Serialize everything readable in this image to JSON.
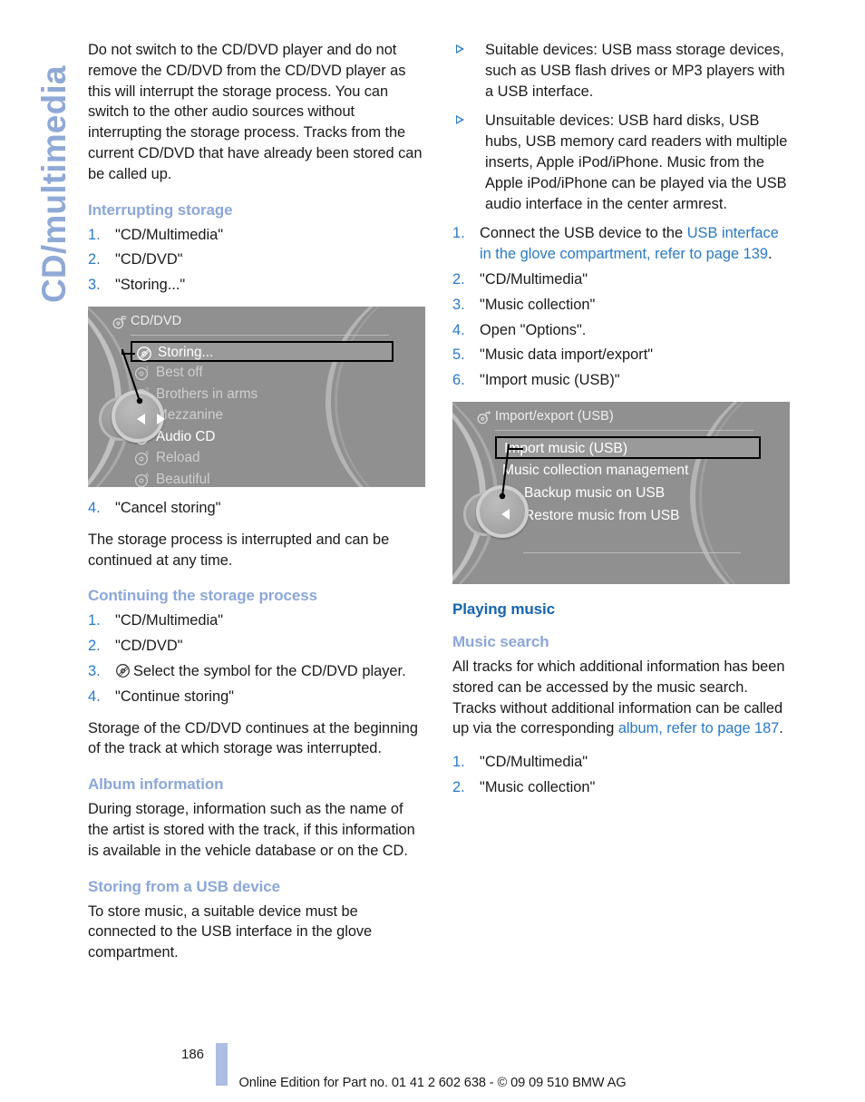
{
  "side_tab": {
    "label": "CD/multimedia"
  },
  "colors": {
    "heading_main": "#1565b0",
    "heading_sub": "#8ba7d9",
    "link": "#2a79c8",
    "side_tab": "#8fa9d7",
    "footer_bar": "#aebde3",
    "idrive_background": "#909090"
  },
  "left_column": {
    "intro_paragraph": "Do not switch to the CD/DVD player and do not remove the CD/DVD from the CD/DVD player as this will interrupt the storage process. You can switch to the other audio sources without interrupting the storage process. Tracks from the current CD/DVD that have already been stored can be called up.",
    "interrupting_heading": "Interrupting storage",
    "interrupting_steps": [
      {
        "num": "1.",
        "text": "\"CD/Multimedia\""
      },
      {
        "num": "2.",
        "text": "\"CD/DVD\""
      },
      {
        "num": "3.",
        "text": "\"Storing...\""
      }
    ],
    "after_figure_steps": [
      {
        "num": "4.",
        "text": "\"Cancel storing\""
      }
    ],
    "after_figure_paragraph": "The storage process is interrupted and can be continued at any time.",
    "continuing_heading": "Continuing the storage process",
    "continuing_steps": [
      {
        "num": "1.",
        "text": "\"CD/Multimedia\""
      },
      {
        "num": "2.",
        "text": "\"CD/DVD\""
      },
      {
        "num": "3.",
        "text": "Select the symbol for the CD/DVD player.",
        "icon": "cd-disc-icon"
      },
      {
        "num": "4.",
        "text": "\"Continue storing\""
      }
    ],
    "continuing_paragraph": "Storage of the CD/DVD continues at the beginning of the track at which storage was interrupted.",
    "album_heading": "Album information",
    "album_paragraph": "During storage, information such as the name of the artist is stored with the track, if this information is available in the vehicle database or on the CD.",
    "usb_heading": "Storing from a USB device",
    "usb_paragraph": "To store music, a suitable device must be connected to the USB interface in the glove compartment."
  },
  "right_column": {
    "bullets": [
      {
        "marker": "triangle-bullet-icon",
        "text": "Suitable devices: USB mass storage devices, such as USB flash drives or MP3 players with a USB interface."
      },
      {
        "marker": "triangle-bullet-icon",
        "text": "Unsuitable devices: USB hard disks, USB hubs, USB memory card readers with multiple inserts, Apple iPod/iPhone. Music from the Apple iPod/iPhone can be played via the USB audio interface in the center armrest."
      }
    ],
    "steps": [
      {
        "num": "1.",
        "text_before": "Connect the USB device to the ",
        "link_text": "USB interface in the glove compartment, refer to page 139",
        "text_after": "."
      },
      {
        "num": "2.",
        "text": "\"CD/Multimedia\""
      },
      {
        "num": "3.",
        "text": "\"Music collection\""
      },
      {
        "num": "4.",
        "text": "Open \"Options\"."
      },
      {
        "num": "5.",
        "text": "\"Music data import/export\""
      },
      {
        "num": "6.",
        "text": "\"Import music (USB)\""
      }
    ],
    "playing_heading": "Playing music",
    "search_heading": "Music search",
    "search_paragraph_before": "All tracks for which additional information has been stored can be accessed by the music search. Tracks without additional information can be called up via the corresponding ",
    "search_link": "album, refer to page 187",
    "search_paragraph_after": ".",
    "search_steps": [
      {
        "num": "1.",
        "text": "\"CD/Multimedia\""
      },
      {
        "num": "2.",
        "text": "\"Music collection\""
      }
    ]
  },
  "figure_cd_dvd": {
    "title": "CD/DVD",
    "title_icon": "cd-multimedia-icon",
    "items": [
      {
        "label": "Storing...",
        "state": "selected",
        "icon": "cd-disc-icon"
      },
      {
        "label": "Best off",
        "state": "dim",
        "icon": "cd-disc-1-icon"
      },
      {
        "label": "Brothers in arms",
        "state": "dim",
        "icon": "cd-disc-2-icon"
      },
      {
        "label": "Mezzanine",
        "state": "dim",
        "icon": "cd-disc-3-icon"
      },
      {
        "label": "Audio CD",
        "state": "bright",
        "icon": "cd-disc-4-icon"
      },
      {
        "label": "Reload",
        "state": "dim",
        "icon": "cd-disc-5-icon"
      },
      {
        "label": "Beautiful",
        "state": "dim",
        "icon": "cd-disc-6-icon"
      }
    ],
    "controller": "idrive-controller-left-right"
  },
  "figure_import_export": {
    "title": "Import/export (USB)",
    "title_icon": "import-export-icon",
    "items": [
      {
        "label": "Import music (USB)",
        "state": "selected"
      },
      {
        "label": "Music collection management",
        "state": "bright"
      },
      {
        "label": "Backup music on USB",
        "state": "bright"
      },
      {
        "label": "Restore music from USB",
        "state": "bright"
      }
    ],
    "controller": "idrive-controller-left"
  },
  "footer": {
    "page_number": "186",
    "note": "Online Edition for Part no. 01 41 2 602 638 - © 09 09 510 BMW AG"
  }
}
